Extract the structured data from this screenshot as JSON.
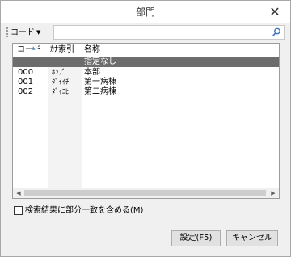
{
  "window": {
    "title": "部門",
    "close_glyph": "✕"
  },
  "toolbar": {
    "search_field_label": "コード",
    "search_value": ""
  },
  "list": {
    "columns": [
      "コード",
      "ｶﾅ索引",
      "名称"
    ],
    "rows": [
      {
        "code": "",
        "kana": "",
        "name": "指定なし",
        "selected": true
      },
      {
        "code": "000",
        "kana": "ﾎﾝﾌﾞ",
        "name": "本部",
        "selected": false
      },
      {
        "code": "001",
        "kana": "ﾀﾞｲｲﾁ",
        "name": "第一病棟",
        "selected": false
      },
      {
        "code": "002",
        "kana": "ﾀﾞｲﾆﾋ",
        "name": "第二病棟",
        "selected": false
      }
    ]
  },
  "options": {
    "partial_match_label": "検索結果に部分一致を含める(M)",
    "partial_match_checked": false
  },
  "buttons": {
    "ok_label": "設定(F5)",
    "cancel_label": "キャンセル"
  },
  "icons": {
    "search": "search-icon",
    "close": "close-icon",
    "dropdown": "chevron-down-icon",
    "sort": "sort-up-icon"
  }
}
